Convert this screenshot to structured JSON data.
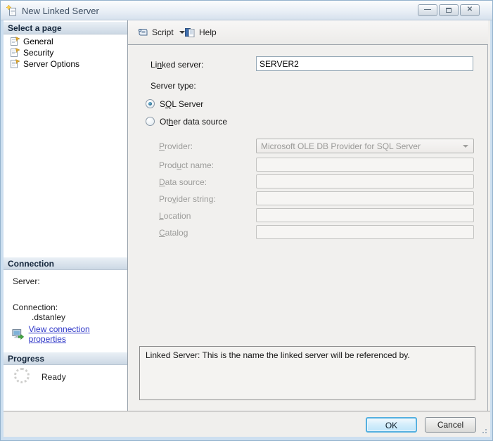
{
  "window": {
    "title": "New Linked Server",
    "controls": [
      {
        "name": "minimize",
        "glyph": "—"
      },
      {
        "name": "maximize",
        "glyph": ""
      },
      {
        "name": "close",
        "glyph": "✕"
      }
    ]
  },
  "sidebar": {
    "select_page": {
      "header": "Select a page",
      "items": [
        {
          "label": "General"
        },
        {
          "label": "Security"
        },
        {
          "label": "Server Options"
        }
      ]
    },
    "connection": {
      "header": "Connection",
      "server_label": "Server:",
      "connection_label": "Connection:",
      "connection_value": ".dstanley",
      "link_label": "View connection properties"
    },
    "progress": {
      "header": "Progress",
      "status": "Ready"
    }
  },
  "toolbar": {
    "script_label": "Script",
    "help_label": "Help"
  },
  "form": {
    "linked_server_label": {
      "pre": "Li",
      "key": "n",
      "post": "ked server:"
    },
    "linked_server_value": "SERVER2",
    "server_type_label": "Server type:",
    "radio_sql": {
      "pre": "S",
      "key": "Q",
      "post": "L Server"
    },
    "radio_other": {
      "pre": "Ot",
      "key": "h",
      "post": "er data source"
    },
    "fields": [
      {
        "label": {
          "pre": "",
          "key": "P",
          "post": "rovider:"
        },
        "value": "Microsoft OLE DB Provider for SQL Server",
        "type": "select",
        "disabled": true
      },
      {
        "label": {
          "pre": "Prod",
          "key": "u",
          "post": "ct name:"
        },
        "value": "",
        "type": "text",
        "disabled": true
      },
      {
        "label": {
          "pre": "",
          "key": "D",
          "post": "ata source:"
        },
        "value": "",
        "type": "text",
        "disabled": true
      },
      {
        "label": {
          "pre": "Pro",
          "key": "v",
          "post": "ider string:"
        },
        "value": "",
        "type": "text",
        "disabled": true
      },
      {
        "label": {
          "pre": "",
          "key": "L",
          "post": "ocation"
        },
        "value": "",
        "type": "text",
        "disabled": true
      },
      {
        "label": {
          "pre": "",
          "key": "C",
          "post": "atalog"
        },
        "value": "",
        "type": "text",
        "disabled": true
      }
    ],
    "help_text": "Linked Server: This is the name the linked server will be referenced by."
  },
  "footer": {
    "ok_label": "OK",
    "cancel_label": "Cancel"
  },
  "colors": {
    "window_border": "#93b2cd",
    "titlebar_gradient_bottom": "#d6e1ed",
    "panel_header_bottom": "#ccd8e4",
    "link": "#3038c8",
    "ok_focus_border": "#54b0e0",
    "disabled_text": "#9c9c9a"
  }
}
